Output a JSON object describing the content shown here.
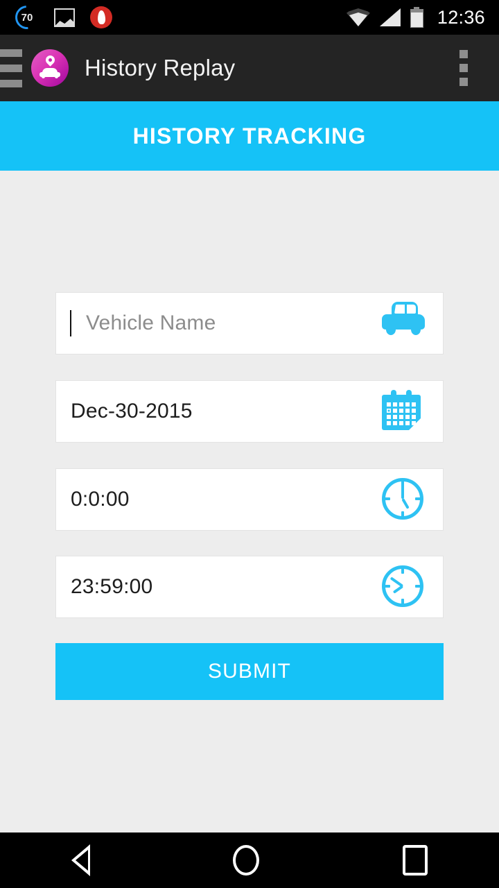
{
  "status_bar": {
    "time": "12:36",
    "left_icons": [
      {
        "name": "speed-limit-70-icon",
        "value": "70"
      },
      {
        "name": "gallery-image-icon"
      },
      {
        "name": "flame-notification-icon"
      }
    ],
    "right_icons": [
      {
        "name": "wifi-icon"
      },
      {
        "name": "cell-signal-icon"
      },
      {
        "name": "battery-icon"
      }
    ]
  },
  "app_bar": {
    "menu_icon": "hamburger-menu-icon",
    "logo_icon": "car-location-pin-logo",
    "title": "History Replay",
    "overflow_icon": "overflow-menu-icon"
  },
  "banner": {
    "title": "HISTORY TRACKING",
    "background": "#15c2f7"
  },
  "form": {
    "fields": [
      {
        "name": "vehicle-name",
        "value": "",
        "placeholder": "Vehicle Name",
        "icon": "car-icon",
        "has_caret": true
      },
      {
        "name": "date",
        "value": "Dec-30-2015",
        "placeholder": "",
        "icon": "calendar-icon",
        "has_caret": false
      },
      {
        "name": "start-time",
        "value": "0:0:00",
        "placeholder": "",
        "icon": "clock-icon",
        "has_caret": false
      },
      {
        "name": "end-time",
        "value": "23:59:00",
        "placeholder": "",
        "icon": "clock-icon",
        "has_caret": false
      }
    ],
    "submit_label": "SUBMIT"
  },
  "nav_bar": {
    "back": "back-nav-icon",
    "home": "home-nav-icon",
    "recents": "recents-nav-icon"
  },
  "colors": {
    "accent": "#15c2f7",
    "icon_accent": "#2ec2f3",
    "page_background": "#ededed",
    "app_bar": "#242424",
    "status_bar": "#000000"
  }
}
